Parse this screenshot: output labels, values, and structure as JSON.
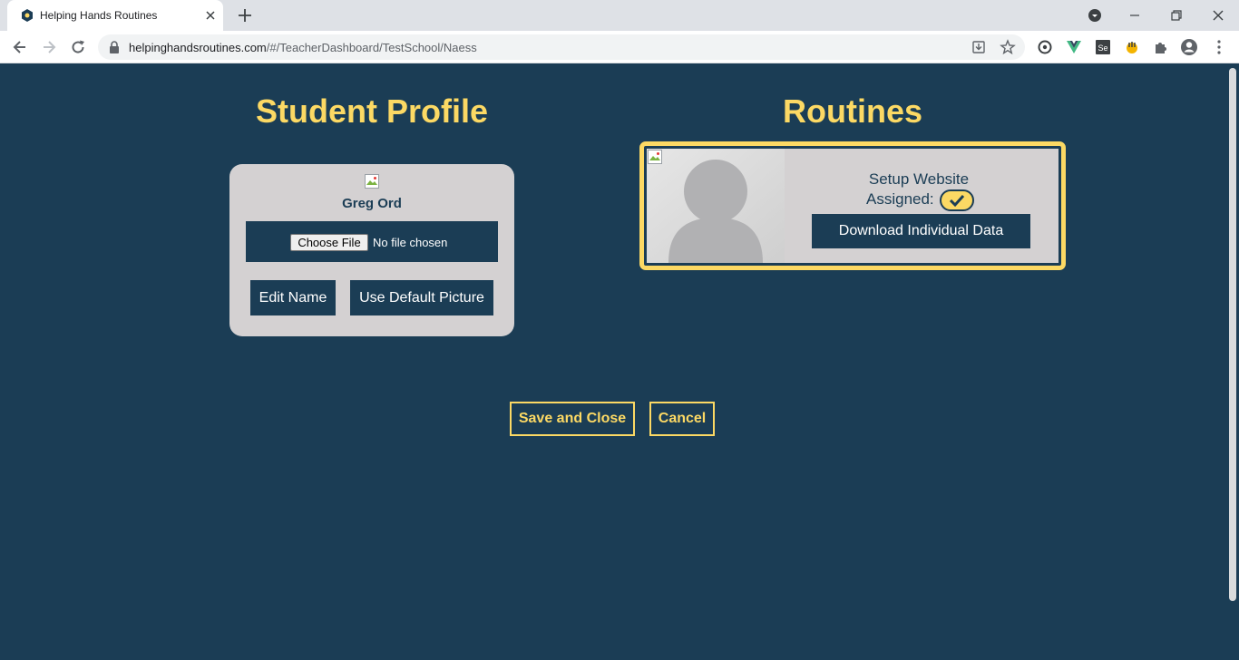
{
  "browser": {
    "tab_title": "Helping Hands Routines",
    "url_host": "helpinghandsroutines.com",
    "url_path": "/#/TeacherDashboard/TestSchool/Naess"
  },
  "profile": {
    "heading": "Student Profile",
    "student_name": "Greg Ord",
    "choose_file_label": "Choose File",
    "no_file_text": "No file chosen",
    "edit_name_label": "Edit Name",
    "default_picture_label": "Use Default Picture"
  },
  "routines": {
    "heading": "Routines",
    "items": [
      {
        "name": "Setup Website",
        "assigned_label": "Assigned:",
        "assigned": true,
        "download_label": "Download Individual Data"
      }
    ]
  },
  "actions": {
    "save_label": "Save and Close",
    "cancel_label": "Cancel"
  },
  "colors": {
    "background": "#1b3d55",
    "accent": "#fcd964",
    "card": "#d4d1d2"
  }
}
